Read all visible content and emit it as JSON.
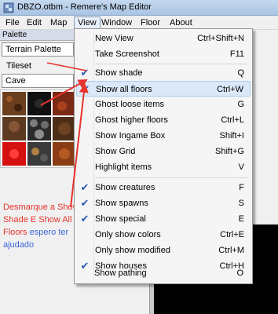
{
  "window": {
    "title": "DBZO.otbm - Remere's Map Editor"
  },
  "menubar": {
    "items": [
      {
        "label": "File"
      },
      {
        "label": "Edit"
      },
      {
        "label": "Map"
      },
      {
        "label": "View"
      },
      {
        "label": "Window"
      },
      {
        "label": "Floor"
      },
      {
        "label": "About"
      }
    ]
  },
  "palette": {
    "header": "Palette",
    "palette_select": "Terrain Palette",
    "tileset_label": "Tileset",
    "tileset_select": "Cave"
  },
  "annotation": {
    "line1": "Desmarque a Show",
    "line2": "Shade E Show All",
    "line3_red": "Floors ",
    "line3_blue": "espero ter",
    "line4": "ajudado"
  },
  "view_menu": {
    "items": [
      {
        "label": "New View",
        "shortcut": "Ctrl+Shift+N",
        "checked": false
      },
      {
        "label": "Take Screenshot",
        "shortcut": "F11",
        "checked": false
      },
      {
        "label": "Show shade",
        "shortcut": "Q",
        "checked": true
      },
      {
        "label": "Show all floors",
        "shortcut": "Ctrl+W",
        "checked": true
      },
      {
        "label": "Ghost loose items",
        "shortcut": "G",
        "checked": false
      },
      {
        "label": "Ghost higher floors",
        "shortcut": "Ctrl+L",
        "checked": false
      },
      {
        "label": "Show Ingame Box",
        "shortcut": "Shift+I",
        "checked": false
      },
      {
        "label": "Show Grid",
        "shortcut": "Shift+G",
        "checked": false
      },
      {
        "label": "Highlight items",
        "shortcut": "V",
        "checked": false
      },
      {
        "label": "Show creatures",
        "shortcut": "F",
        "checked": true
      },
      {
        "label": "Show spawns",
        "shortcut": "S",
        "checked": true
      },
      {
        "label": "Show special",
        "shortcut": "E",
        "checked": true
      },
      {
        "label": "Only show colors",
        "shortcut": "Ctrl+E",
        "checked": false
      },
      {
        "label": "Only show modified",
        "shortcut": "Ctrl+M",
        "checked": false
      },
      {
        "label": "Show houses",
        "shortcut": "Ctrl+H",
        "checked": true
      },
      {
        "label": "Show pathing",
        "shortcut": "O",
        "checked": false
      }
    ]
  },
  "colors": {
    "annotation_red": "#e8322b",
    "annotation_blue": "#3c64d8",
    "check_blue": "#2a5bb8",
    "highlight": "#dbe8f8"
  }
}
